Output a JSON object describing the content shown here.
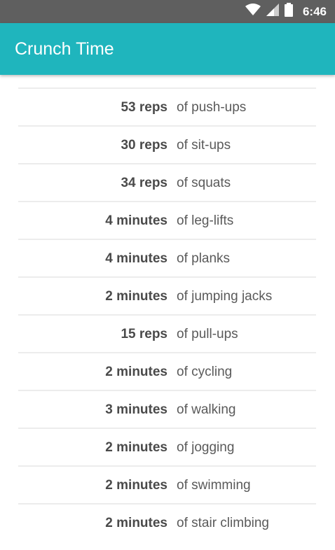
{
  "status_bar": {
    "time": "6:46",
    "icons": [
      "wifi-icon",
      "cell-signal-icon",
      "battery-icon"
    ]
  },
  "app_bar": {
    "title": "Crunch Time"
  },
  "colors": {
    "accent": "#1fb5bd",
    "status_bar": "#5f5f5f"
  },
  "exercises": [
    {
      "amount": "53 reps",
      "activity": "of push-ups"
    },
    {
      "amount": "30 reps",
      "activity": "of sit-ups"
    },
    {
      "amount": "34 reps",
      "activity": "of squats"
    },
    {
      "amount": "4 minutes",
      "activity": "of leg-lifts"
    },
    {
      "amount": "4 minutes",
      "activity": "of planks"
    },
    {
      "amount": "2 minutes",
      "activity": "of jumping jacks"
    },
    {
      "amount": "15 reps",
      "activity": "of pull-ups"
    },
    {
      "amount": "2 minutes",
      "activity": "of cycling"
    },
    {
      "amount": "3 minutes",
      "activity": "of walking"
    },
    {
      "amount": "2 minutes",
      "activity": "of jogging"
    },
    {
      "amount": "2 minutes",
      "activity": "of swimming"
    },
    {
      "amount": "2 minutes",
      "activity": "of stair climbing"
    }
  ]
}
